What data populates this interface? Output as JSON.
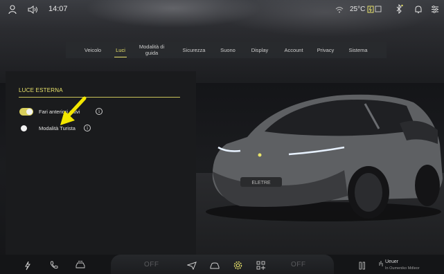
{
  "status_bar": {
    "time": "14:07",
    "temperature": "25°C",
    "icons": [
      "user-icon",
      "volume-icon",
      "wifi-icon",
      "ev-charge-icon",
      "bluetooth-icon",
      "bell-icon",
      "settings-sliders-icon"
    ]
  },
  "tabs": [
    {
      "label": "Veicolo",
      "active": false
    },
    {
      "label": "Luci",
      "active": true
    },
    {
      "label": "Modalità di guida",
      "active": false
    },
    {
      "label": "Sicurezza",
      "active": false
    },
    {
      "label": "Suono",
      "active": false
    },
    {
      "label": "Display",
      "active": false
    },
    {
      "label": "Account",
      "active": false
    },
    {
      "label": "Privacy",
      "active": false
    },
    {
      "label": "Sistema",
      "active": false
    }
  ],
  "section": {
    "title": "LUCE ESTERNA",
    "options": [
      {
        "label": "Fari anteriori attivi",
        "enabled": true
      },
      {
        "label": "Modalità Turista",
        "enabled": false
      }
    ]
  },
  "car": {
    "badge": "ELETRE"
  },
  "dock": {
    "left_climate": "OFF",
    "right_climate": "OFF",
    "weather_city": "Ueuer",
    "weather_desc": "In Oumeniko Mdleor"
  },
  "colors": {
    "accent": "#e9e36b",
    "background": "#141518",
    "panel": "#1a1b1d"
  }
}
